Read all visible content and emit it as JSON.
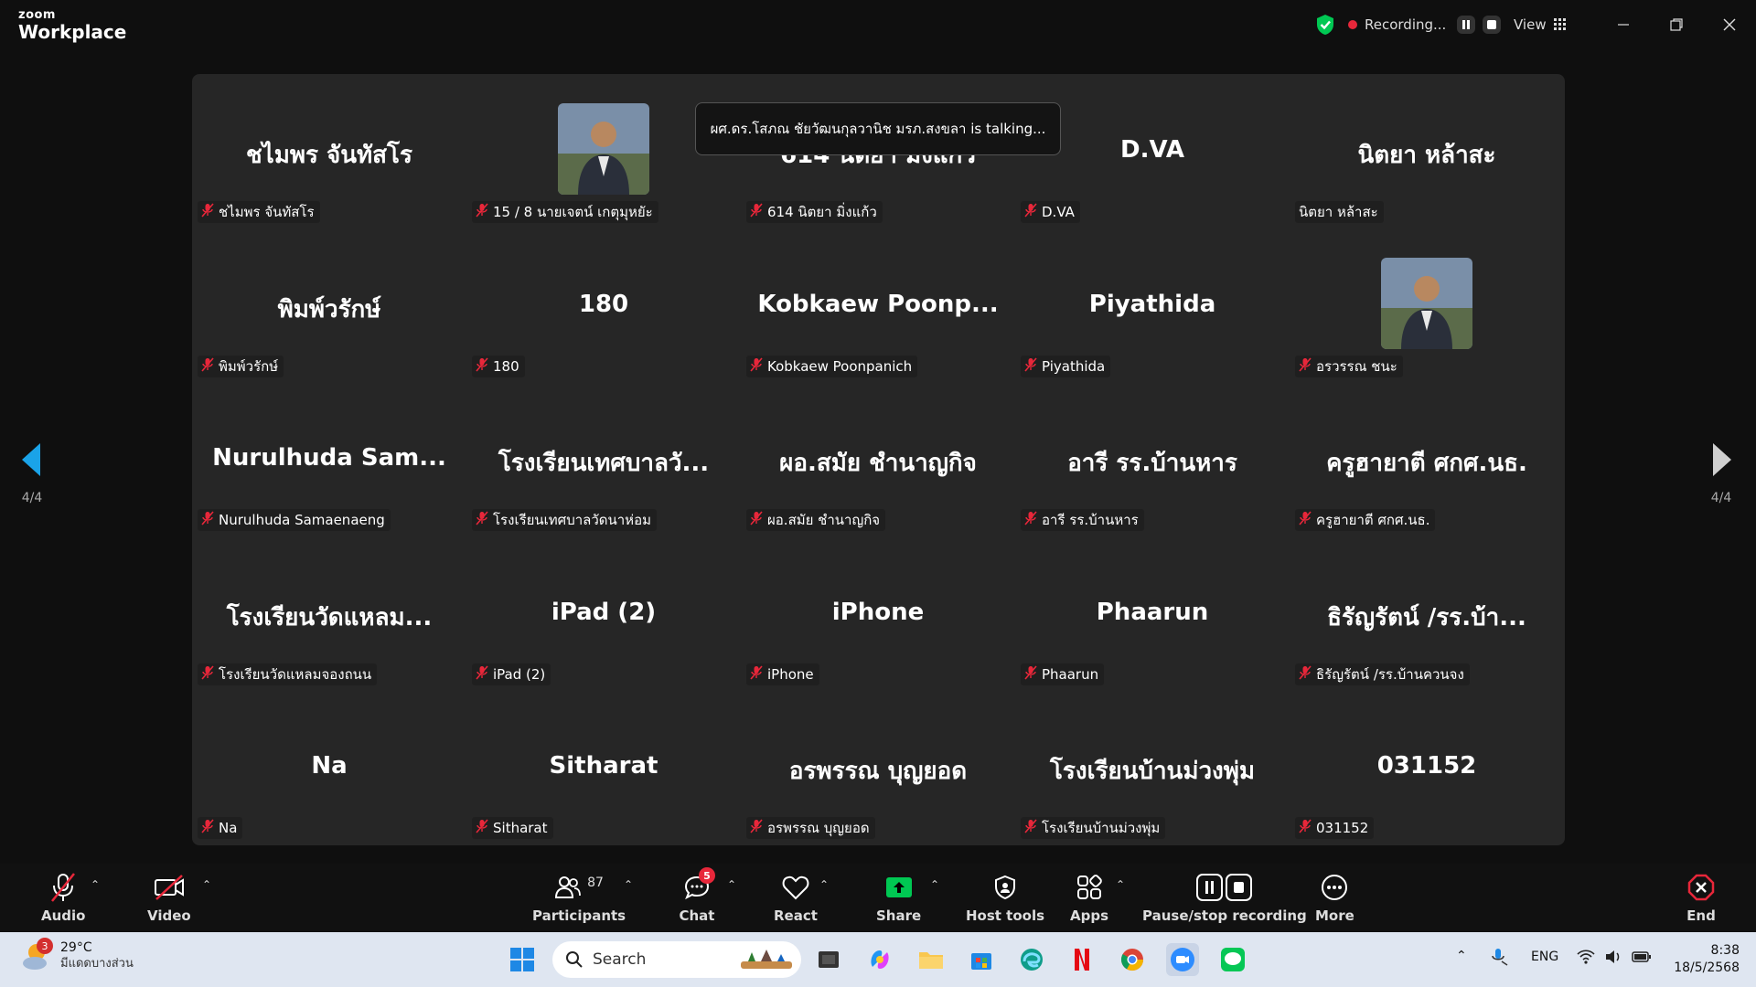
{
  "app": {
    "logo_small": "zoom",
    "logo_big": "Workplace"
  },
  "titlebar": {
    "recording_label": "Recording...",
    "view_label": "View"
  },
  "talking_banner": "ผศ.ดร.โสภณ ชัยวัฒนกุลวานิช มรภ.สงขลา is talking...",
  "page_indicator": {
    "left": "4/4",
    "right": "4/4"
  },
  "participants": [
    {
      "display": "ชไมพร  จันทัสโร",
      "label": "ชไมพร  จันทัสโร",
      "muted": true,
      "photo": false
    },
    {
      "display": "",
      "label": "15 / 8 นายเจตน์ เกตุมุหยัะ",
      "muted": true,
      "photo": true
    },
    {
      "display": "614 นิตยา  มิ่งแก้ว",
      "label": "614 นิตยา  มิ่งแก้ว",
      "muted": true,
      "photo": false
    },
    {
      "display": "D.VA",
      "label": "D.VA",
      "muted": true,
      "photo": false
    },
    {
      "display": "นิตยา  หล้าสะ",
      "label": "นิตยา  หล้าสะ",
      "muted": false,
      "photo": false
    },
    {
      "display": "พิมพ์วรักษ์",
      "label": "พิมพ์วรักษ์",
      "muted": true,
      "photo": false
    },
    {
      "display": "180",
      "label": "180",
      "muted": true,
      "photo": false
    },
    {
      "display": "Kobkaew  Poonp...",
      "label": "Kobkaew Poonpanich",
      "muted": true,
      "photo": false
    },
    {
      "display": "Piyathida",
      "label": "Piyathida",
      "muted": true,
      "photo": false
    },
    {
      "display": "",
      "label": "อรวรรณ ชนะ",
      "muted": true,
      "photo": true
    },
    {
      "display": "Nurulhuda  Sam...",
      "label": "Nurulhuda Samaenaeng",
      "muted": true,
      "photo": false
    },
    {
      "display": "โรงเรียนเทศบาลวั...",
      "label": "โรงเรียนเทศบาลวัดนาห่อม",
      "muted": true,
      "photo": false
    },
    {
      "display": "ผอ.สมัย  ชำนาญกิจ",
      "label": "ผอ.สมัย  ชำนาญกิจ",
      "muted": true,
      "photo": false
    },
    {
      "display": "อารี รร.บ้านหาร",
      "label": "อารี รร.บ้านหาร",
      "muted": true,
      "photo": false
    },
    {
      "display": "ครูฮายาตี ศกศ.นธ.",
      "label": "ครูฮายาตี ศกศ.นธ.",
      "muted": true,
      "photo": false
    },
    {
      "display": "โรงเรียนวัดแหลม...",
      "label": "โรงเรียนวัดแหลมจองถนน",
      "muted": true,
      "photo": false
    },
    {
      "display": "iPad (2)",
      "label": "iPad (2)",
      "muted": true,
      "photo": false
    },
    {
      "display": "iPhone",
      "label": "iPhone",
      "muted": true,
      "photo": false
    },
    {
      "display": "Phaarun",
      "label": "Phaarun",
      "muted": true,
      "photo": false
    },
    {
      "display": "ธิรัญรัตน์ /รร.บ้า...",
      "label": "ธิรัญรัตน์ /รร.บ้านควนจง",
      "muted": true,
      "photo": false
    },
    {
      "display": "Na",
      "label": "Na",
      "muted": true,
      "photo": false
    },
    {
      "display": "Sitharat",
      "label": "Sitharat",
      "muted": true,
      "photo": false
    },
    {
      "display": "อรพรรณ บุญยอด",
      "label": "อรพรรณ บุญยอด",
      "muted": true,
      "photo": false
    },
    {
      "display": "โรงเรียนบ้านม่วงพุ่ม",
      "label": "โรงเรียนบ้านม่วงพุ่ม",
      "muted": true,
      "photo": false
    },
    {
      "display": "031152",
      "label": "031152",
      "muted": true,
      "photo": false
    }
  ],
  "toolbar": {
    "audio": "Audio",
    "video": "Video",
    "participants": "Participants",
    "participants_count": "87",
    "chat": "Chat",
    "chat_badge": "5",
    "react": "React",
    "share": "Share",
    "host_tools": "Host tools",
    "apps": "Apps",
    "pause_stop": "Pause/stop recording",
    "more": "More",
    "end": "End"
  },
  "taskbar": {
    "weather_temp": "29°C",
    "weather_desc": "มีแดดบางส่วน",
    "weather_badge": "3",
    "search_placeholder": "Search",
    "lang": "ENG",
    "time": "8:38",
    "date": "18/5/2568"
  },
  "colors": {
    "accent_green": "#00c853",
    "record_red": "#e8273a",
    "mute_red": "#e8273a",
    "nav_blue": "#1aa3e8"
  }
}
